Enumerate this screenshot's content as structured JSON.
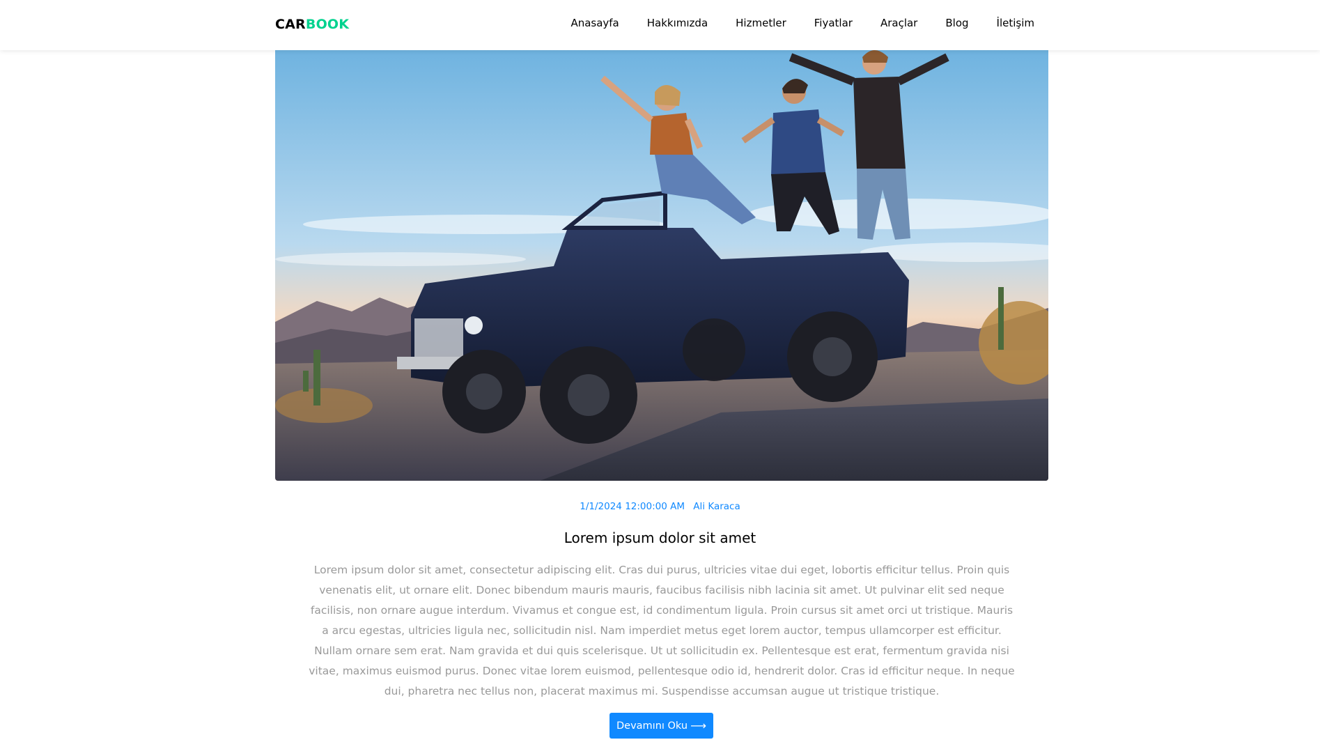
{
  "brand": {
    "part1": "CAR",
    "part2": "BOOK",
    "part1_color": "#000000",
    "part2_color": "#01d28e"
  },
  "nav": {
    "items": [
      {
        "label": "Anasayfa"
      },
      {
        "label": "Hakkımızda"
      },
      {
        "label": "Hizmetler"
      },
      {
        "label": "Fiyatlar"
      },
      {
        "label": "Araçlar"
      },
      {
        "label": "Blog"
      },
      {
        "label": "İletişim"
      }
    ]
  },
  "post": {
    "date": "1/1/2024 12:00:00 AM",
    "author": "Ali Karaca",
    "title": "Lorem ipsum dolor sit amet",
    "body": "Lorem ipsum dolor sit amet, consectetur adipiscing elit. Cras dui purus, ultricies vitae dui eget, lobortis efficitur tellus. Proin quis venenatis elit, ut ornare elit. Donec bibendum mauris mauris, faucibus facilisis nibh lacinia sit amet. Ut pulvinar elit sed neque facilisis, non ornare augue interdum. Vivamus et congue est, id condimentum ligula. Proin cursus sit amet orci ut tristique. Mauris a arcu egestas, ultricies ligula nec, sollicitudin nisl. Nam imperdiet metus eget lorem auctor, tempus ullamcorper est efficitur. Nullam ornare sem erat. Nam gravida et dui quis scelerisque. Ut ut sollicitudin ex. Pellentesque est erat, fermentum gravida nisi vitae, maximus euismod purus. Donec vitae lorem euismod, pellentesque odio id, hendrerit dolor. Cras id efficitur neque. In neque dui, pharetra nec tellus non, placerat maximus mi. Suspendisse accumsan augue ut tristique tristique.",
    "read_more_label": "Devamını Oku",
    "read_more_icon": "arrow-right-icon"
  },
  "colors": {
    "accent": "#1089ff",
    "brand_green": "#01d28e",
    "body_text": "#999999"
  }
}
